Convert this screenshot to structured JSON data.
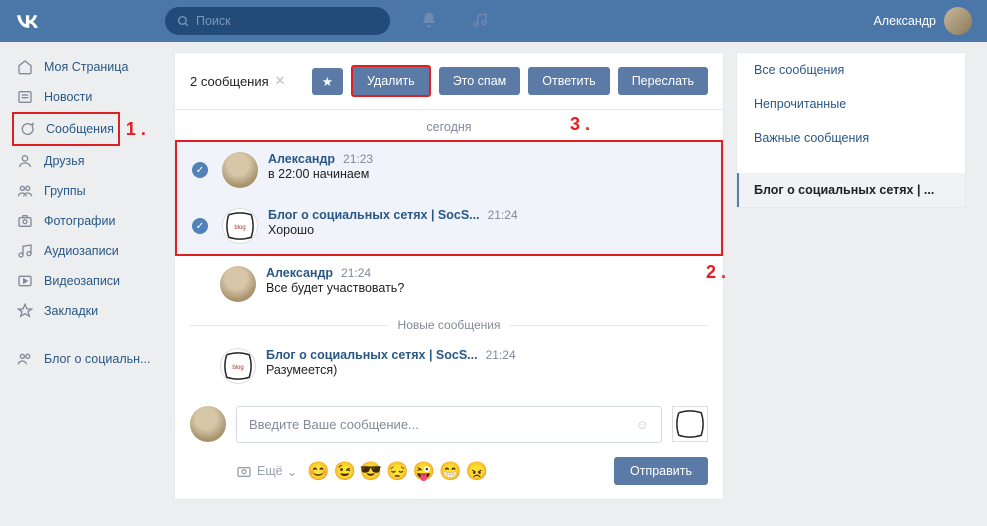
{
  "header": {
    "search_placeholder": "Поиск",
    "user_name": "Александр"
  },
  "nav": {
    "items": [
      {
        "label": "Моя Страница"
      },
      {
        "label": "Новости"
      },
      {
        "label": "Сообщения"
      },
      {
        "label": "Друзья"
      },
      {
        "label": "Группы"
      },
      {
        "label": "Фотографии"
      },
      {
        "label": "Аудиозаписи"
      },
      {
        "label": "Видеозаписи"
      },
      {
        "label": "Закладки"
      }
    ],
    "group_item": "Блог о социальн..."
  },
  "sel_bar": {
    "count": "2 сообщения",
    "star": "★",
    "delete": "Удалить",
    "spam": "Это спам",
    "reply": "Ответить",
    "forward": "Переслать"
  },
  "date_today": "сегодня",
  "messages": [
    {
      "name": "Александр",
      "time": "21:23",
      "text": "в 22:00 начинаем",
      "avatar": "alex",
      "selected": true
    },
    {
      "name": "Блог о социальных сетях | SocS...",
      "time": "21:24",
      "text": "Хорошо",
      "avatar": "blog",
      "selected": true
    },
    {
      "name": "Александр",
      "time": "21:24",
      "text": "Все будет участвовать?",
      "avatar": "alex",
      "selected": false
    }
  ],
  "new_divider": "Новые сообщения",
  "messages2": [
    {
      "name": "Блог о социальных сетях | SocS...",
      "time": "21:24",
      "text": "Разумеется)",
      "avatar": "blog"
    }
  ],
  "compose": {
    "placeholder": "Введите Ваше сообщение...",
    "attach_label": "Ещё",
    "send": "Отправить"
  },
  "filters": [
    {
      "label": "Все сообщения"
    },
    {
      "label": "Непрочитанные"
    },
    {
      "label": "Важные сообщения"
    }
  ],
  "filter_active": "Блог о социальных сетях | ...",
  "annotations": {
    "a1": "1 .",
    "a2": "2 .",
    "a3": "3 ."
  }
}
